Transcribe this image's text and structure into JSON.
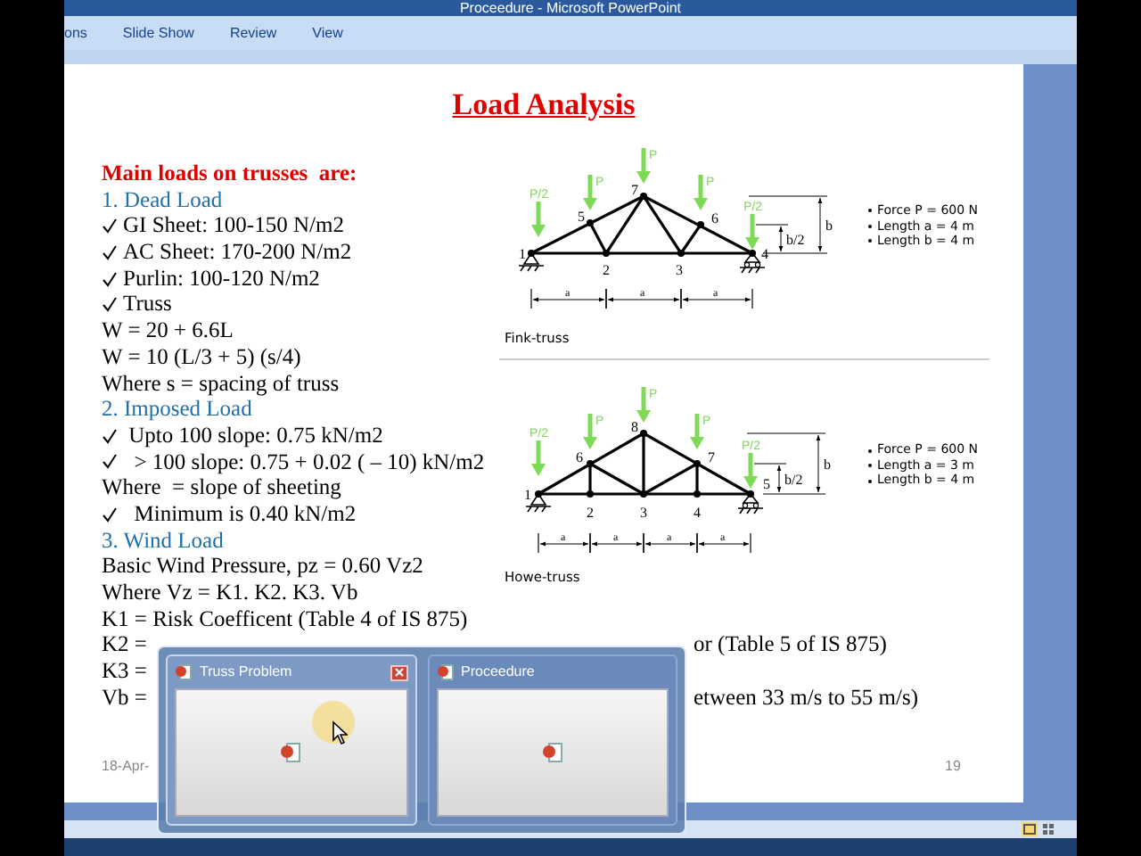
{
  "window": {
    "title": "Proceedure - Microsoft PowerPoint"
  },
  "ribbon_tabs": [
    {
      "label": "ons"
    },
    {
      "label": "Slide Show"
    },
    {
      "label": "Review"
    },
    {
      "label": "View"
    }
  ],
  "slide": {
    "title": "Load Analysis",
    "lines": [
      {
        "kind": "heading",
        "text": "Main loads on trusses  are:"
      },
      {
        "kind": "section",
        "text": "1. Dead Load"
      },
      {
        "kind": "check",
        "text": "GI Sheet: 100-150 N/m2"
      },
      {
        "kind": "check",
        "text": "AC Sheet: 170-200 N/m2"
      },
      {
        "kind": "check",
        "text": "Purlin: 100-120 N/m2"
      },
      {
        "kind": "check",
        "text": "Truss"
      },
      {
        "kind": "plain",
        "text": "W = 20 + 6.6L"
      },
      {
        "kind": "plain",
        "text": "W = 10 (L/3 + 5) (s/4)"
      },
      {
        "kind": "plain",
        "text": "Where s = spacing of truss"
      },
      {
        "kind": "section",
        "text": "2. Imposed Load"
      },
      {
        "kind": "check",
        "text": " Upto 100 slope: 0.75 kN/m2"
      },
      {
        "kind": "check",
        "text": "  > 100 slope: 0.75 + 0.02 ( – 10) kN/m2"
      },
      {
        "kind": "plain",
        "text": "Where  = slope of sheeting"
      },
      {
        "kind": "check",
        "text": "  Minimum is 0.40 kN/m2"
      },
      {
        "kind": "section",
        "text": "3. Wind Load"
      },
      {
        "kind": "plain",
        "text": "Basic Wind Pressure, pz = 0.60 Vz2"
      },
      {
        "kind": "plain",
        "text": "Where Vz = K1. K2. K3. Vb"
      },
      {
        "kind": "plain",
        "text": "K1 = Risk Coefficent (Table 4 of IS 875)"
      },
      {
        "kind": "plain",
        "text": "K2 =",
        "tail": "or (Table 5 of IS 875)"
      },
      {
        "kind": "plain",
        "text": "K3 ="
      },
      {
        "kind": "plain",
        "text": "Vb =",
        "tail": "etween 33 m/s to 55 m/s)"
      }
    ],
    "figures": [
      {
        "kind": "fink",
        "caption": "Fink-truss",
        "loads": [
          "P/2",
          "P",
          "P",
          "P",
          "P/2"
        ],
        "nodes": [
          "1",
          "2",
          "3",
          "4",
          "5",
          "6",
          "7"
        ],
        "spans": [
          "a",
          "a",
          "a"
        ],
        "heights": [
          "b",
          "b/2"
        ],
        "specs": [
          "Force P = 600 N",
          "Length a = 4 m",
          "Length b = 4 m"
        ]
      },
      {
        "kind": "howe",
        "caption": "Howe-truss",
        "loads": [
          "P/2",
          "P",
          "P",
          "P",
          "P/2"
        ],
        "nodes": [
          "1",
          "2",
          "3",
          "4",
          "5",
          "6",
          "7",
          "8"
        ],
        "spans": [
          "a",
          "a",
          "a",
          "a"
        ],
        "heights": [
          "b",
          "b/2"
        ],
        "specs": [
          "Force P = 600 N",
          "Length a = 3 m",
          "Length b = 4 m"
        ]
      }
    ],
    "footer_date": "18-Apr-",
    "page_number": "19"
  },
  "taskbar_previews": [
    {
      "title": "Truss Problem",
      "selected": true
    },
    {
      "title": "Proceedure",
      "selected": false
    }
  ]
}
